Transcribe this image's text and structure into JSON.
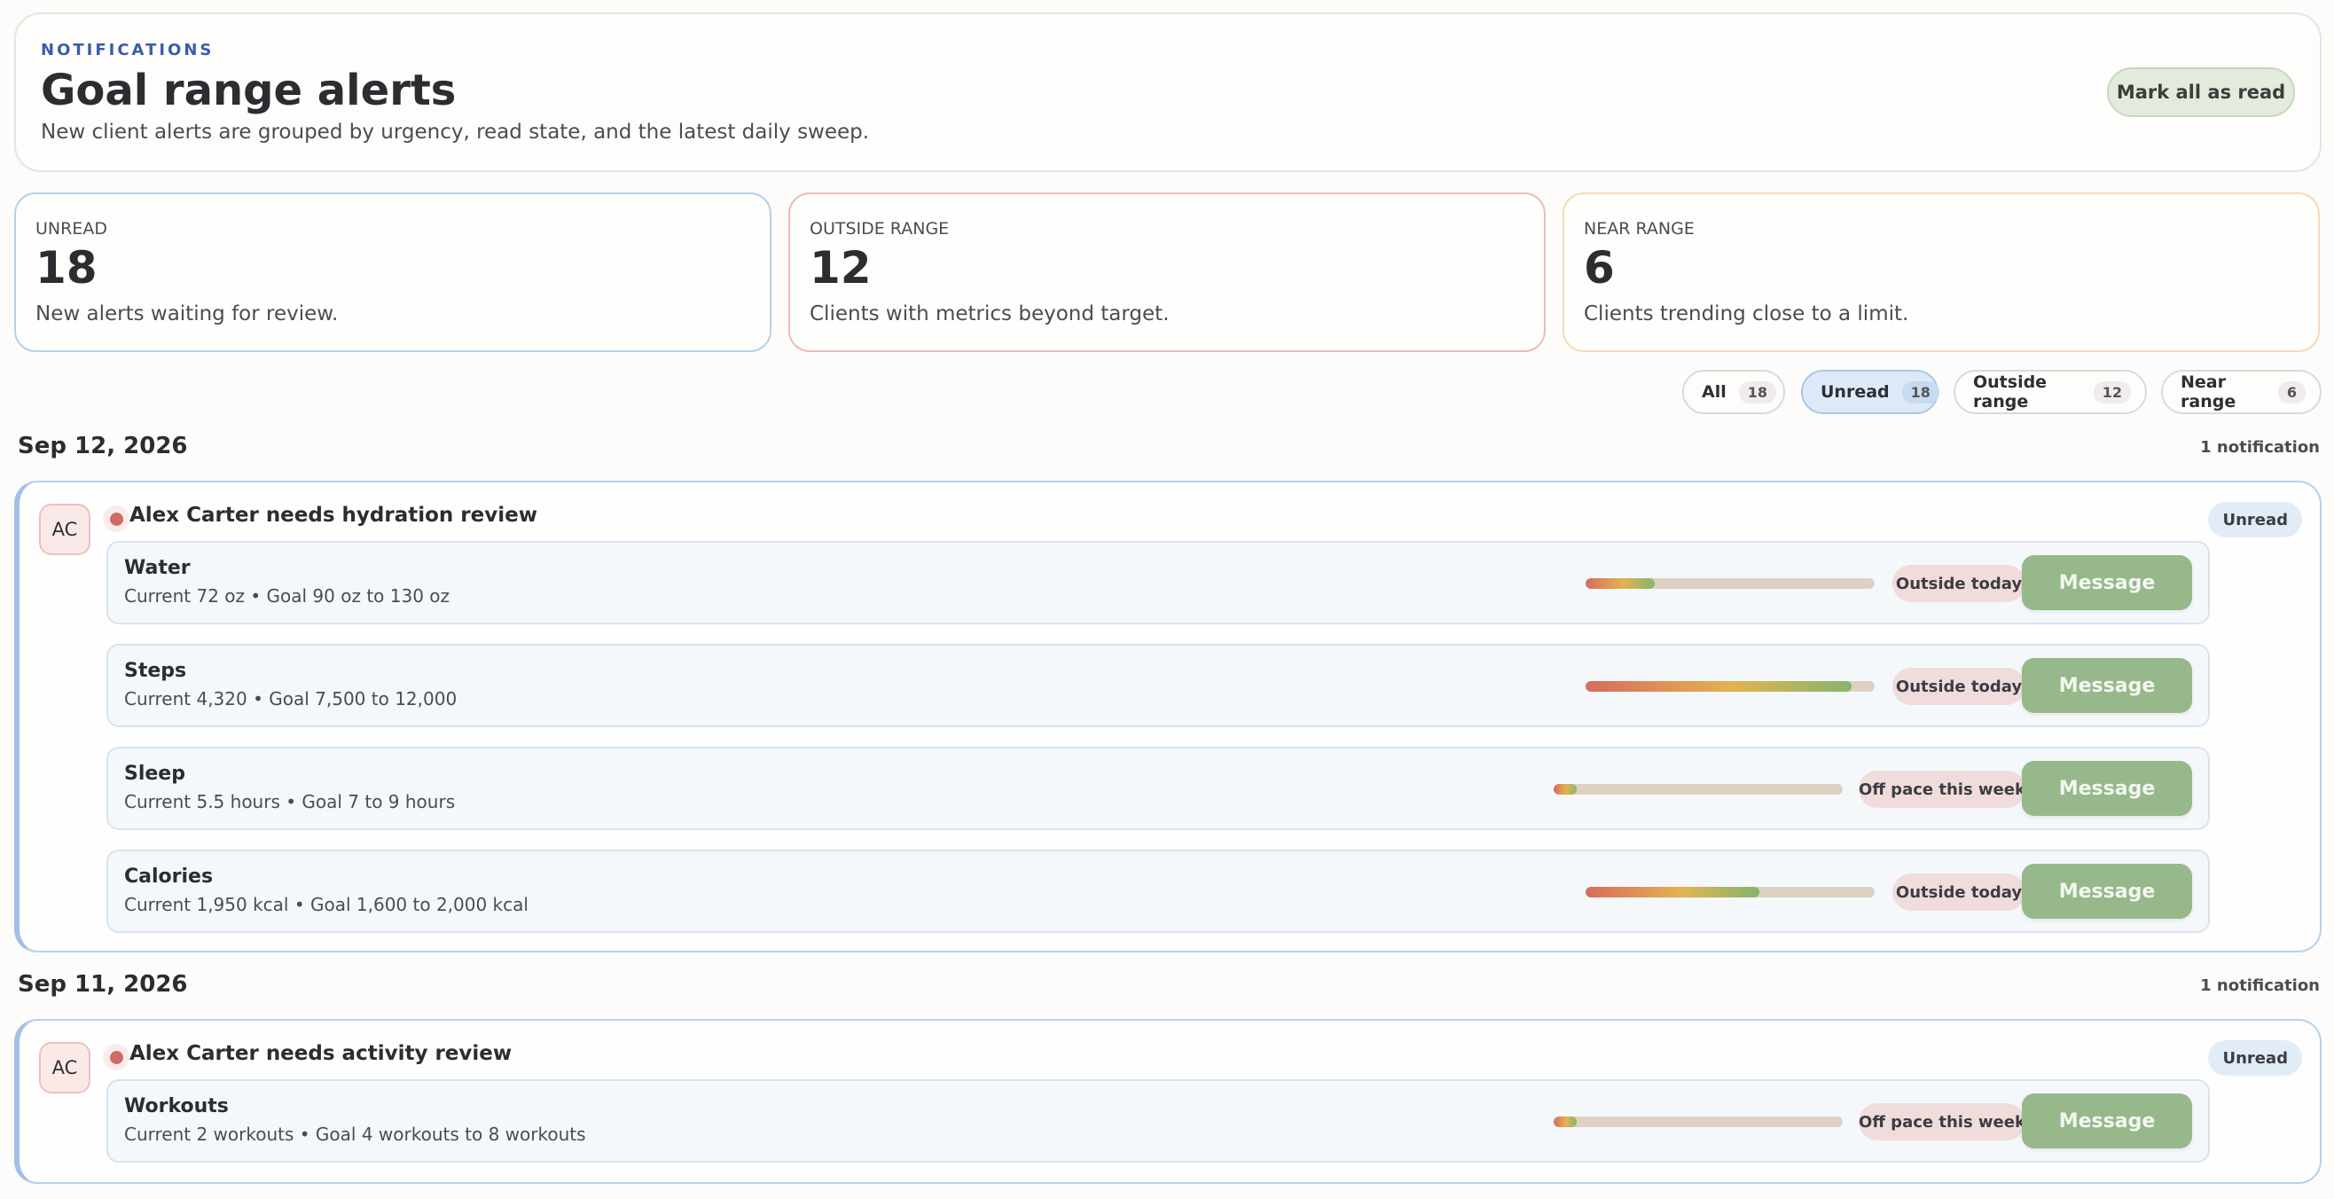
{
  "header": {
    "eyebrow": "NOTIFICATIONS",
    "title": "Goal range alerts",
    "subtitle": "New client alerts are grouped by urgency, read state, and the latest daily sweep.",
    "mark_all_label": "Mark all as read"
  },
  "stats": [
    {
      "label": "UNREAD",
      "value": "18",
      "description": "New alerts waiting for review.",
      "border_color": "#b6d0ea"
    },
    {
      "label": "OUTSIDE RANGE",
      "value": "12",
      "description": "Clients with metrics beyond target.",
      "border_color": "#ecbcb8"
    },
    {
      "label": "NEAR RANGE",
      "value": "6",
      "description": "Clients trending close to a limit.",
      "border_color": "#f2dcb4"
    }
  ],
  "filters": [
    {
      "label": "All",
      "count": "18",
      "active": false
    },
    {
      "label": "Unread",
      "count": "18",
      "active": true
    },
    {
      "label": "Outside range",
      "count": "12",
      "active": false
    },
    {
      "label": "Near range",
      "count": "6",
      "active": false
    }
  ],
  "groups": [
    {
      "date": "Sep 12, 2026",
      "count_label": "1 notification",
      "notification": {
        "avatar": "AC",
        "title": "Alex Carter needs hydration review",
        "status": "Unread",
        "metrics": [
          {
            "name": "Water",
            "detail": "Current 72 oz • Goal 90 oz to 130 oz",
            "progress": 0.24,
            "tag": "Outside today",
            "action": "Message"
          },
          {
            "name": "Steps",
            "detail": "Current 4,320 • Goal 7,500 to 12,000",
            "progress": 0.92,
            "tag": "Outside today",
            "action": "Message"
          },
          {
            "name": "Sleep",
            "detail": "Current 5.5 hours • Goal 7 to 9 hours",
            "progress": 0.08,
            "tag": "Off pace this week",
            "action": "Message"
          },
          {
            "name": "Calories",
            "detail": "Current 1,950 kcal • Goal 1,600 to 2,000 kcal",
            "progress": 0.6,
            "tag": "Outside today",
            "action": "Message"
          }
        ]
      }
    },
    {
      "date": "Sep 11, 2026",
      "count_label": "1 notification",
      "notification": {
        "avatar": "AC",
        "title": "Alex Carter needs activity review",
        "status": "Unread",
        "metrics": [
          {
            "name": "Workouts",
            "detail": "Current 2 workouts • Goal 4 workouts to 8 workouts",
            "progress": 0.08,
            "tag": "Off pace this week",
            "action": "Message"
          }
        ]
      }
    }
  ],
  "colors": {
    "accent": "#3c5ca8",
    "unread_dot": "#d16a66",
    "message_button": "#96b88a",
    "active_filter": "#dde9f6"
  }
}
